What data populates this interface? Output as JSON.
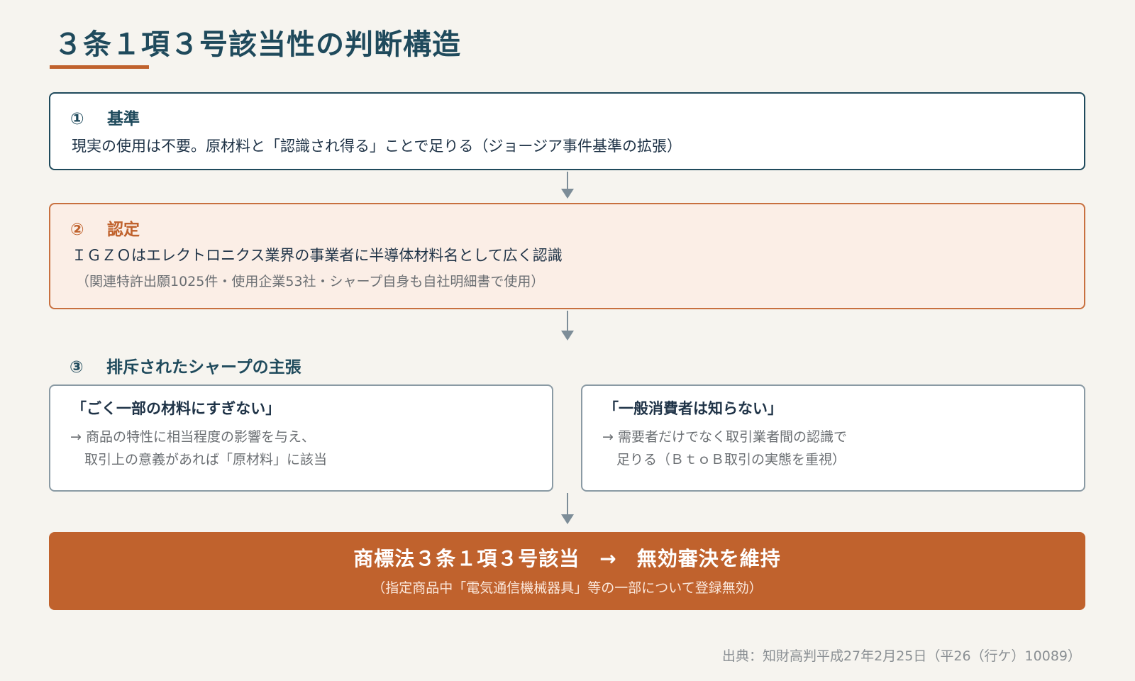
{
  "title": "３条１項３号該当性の判断構造",
  "criteria": {
    "number": "①",
    "heading": "基準",
    "text": "現実の使用は不要。原材料と「認識され得る」ことで足りる（ジョージア事件基準の拡張）"
  },
  "finding": {
    "number": "②",
    "heading": "認定",
    "text": "ＩＧＺＯはエレクトロニクス業界の事業者に半導体材料名として広く認識",
    "detail": "（関連特許出願1025件・使用企業53社・シャープ自身も自社明細書で使用）"
  },
  "rejected": {
    "number": "③",
    "heading": "排斥されたシャープの主張",
    "claims": [
      {
        "quote": "「ごく一部の材料にすぎない」",
        "reason_line1": "→ 商品の特性に相当程度の影響を与え、",
        "reason_line2": "取引上の意義があれば「原材料」に該当"
      },
      {
        "quote": "「一般消費者は知らない」",
        "reason_line1": "→ 需要者だけでなく取引業者間の認識で",
        "reason_line2": "足りる（ＢｔｏＢ取引の実態を重視）"
      }
    ]
  },
  "conclusion": {
    "applies": "商標法３条１項３号該当",
    "arrow": "→",
    "result": "無効審決を維持",
    "detail": "（指定商品中「電気通信機械器具」等の一部について登録無効）"
  },
  "source": "出典：知財高判平成27年2月25日（平26（行ケ）10089）",
  "colors": {
    "accent": "#c0622d",
    "primary": "#1f4a5c",
    "background": "#f6f4ef",
    "finding_bg": "#fbeee6",
    "connector": "#7d8d98"
  }
}
